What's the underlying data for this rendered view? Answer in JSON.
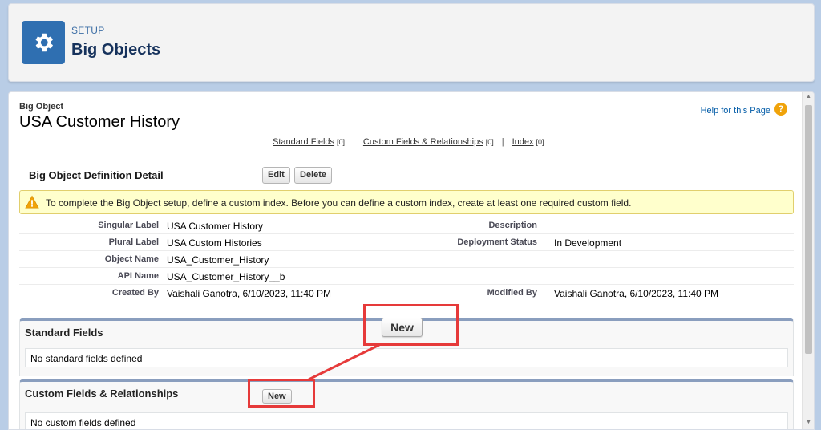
{
  "header": {
    "eyebrow": "SETUP",
    "title": "Big Objects",
    "icon": "gear-icon"
  },
  "object": {
    "type_label": "Big Object",
    "name": "USA Customer History"
  },
  "help": {
    "label": "Help for this Page",
    "icon": "question-icon",
    "icon_glyph": "?"
  },
  "related_links": [
    {
      "label": "Standard Fields",
      "count": "[0]"
    },
    {
      "label": "Custom Fields & Relationships",
      "count": "[0]"
    },
    {
      "label": "Index",
      "count": "[0]"
    }
  ],
  "related_sep": "|",
  "detail": {
    "title": "Big Object Definition Detail",
    "edit_label": "Edit",
    "delete_label": "Delete",
    "warning": "To complete the Big Object setup, define a custom index. Before you can define a custom index, create at least one required custom field.",
    "rows": [
      {
        "label1": "Singular Label",
        "value1": "USA Customer History",
        "label2": "Description",
        "value2": ""
      },
      {
        "label1": "Plural Label",
        "value1": "USA Custom Histories",
        "label2": "Deployment Status",
        "value2": "In Development"
      },
      {
        "label1": "Object Name",
        "value1": "USA_Customer_History",
        "label2": "",
        "value2": ""
      },
      {
        "label1": "API Name",
        "value1": "USA_Customer_History__b",
        "label2": "",
        "value2": ""
      }
    ],
    "created_by_label": "Created By",
    "created_by_user": "Vaishali Ganotra",
    "created_by_date": ", 6/10/2023, 11:40 PM",
    "modified_by_label": "Modified By",
    "modified_by_user": "Vaishali Ganotra",
    "modified_by_date": ", 6/10/2023, 11:40 PM"
  },
  "standard_fields": {
    "title": "Standard Fields",
    "empty": "No standard fields defined"
  },
  "custom_fields": {
    "title": "Custom Fields & Relationships",
    "new_label": "New",
    "empty": "No custom fields defined"
  },
  "callout": {
    "new_label": "New"
  },
  "colors": {
    "accent": "#2f6fb1",
    "callout": "#e63a3a",
    "warning_bg": "#ffffcc"
  }
}
